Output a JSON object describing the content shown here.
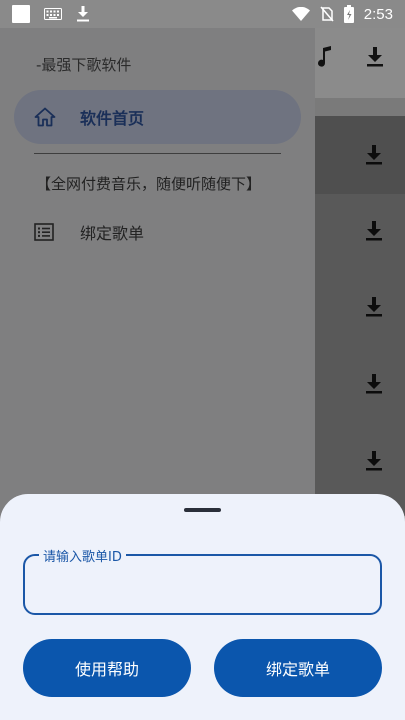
{
  "status_bar": {
    "time": "2:53",
    "icons": [
      "notification-square-icon",
      "keyboard-icon",
      "download-icon",
      "wifi-icon",
      "no-sim-icon",
      "battery-icon"
    ]
  },
  "background": {
    "toolbar_icons": [
      "music-note-icon",
      "download-icon"
    ],
    "row_icons": [
      "download-icon",
      "download-icon",
      "download-icon",
      "download-icon",
      "download-icon",
      "download-icon"
    ]
  },
  "drawer": {
    "subtitle": "-最强下歌软件",
    "home_label": "软件首页",
    "promo_text": "【全网付费音乐，随便听随便下】",
    "bind_label": "绑定歌单"
  },
  "sheet": {
    "field_label": "请输入歌单ID",
    "field_value": "",
    "help_button": "使用帮助",
    "bind_button": "绑定歌单"
  },
  "colors": {
    "accent": "#0b56ad",
    "sheet_bg": "#eef2fb",
    "drawer_active": "#1a2f58"
  }
}
